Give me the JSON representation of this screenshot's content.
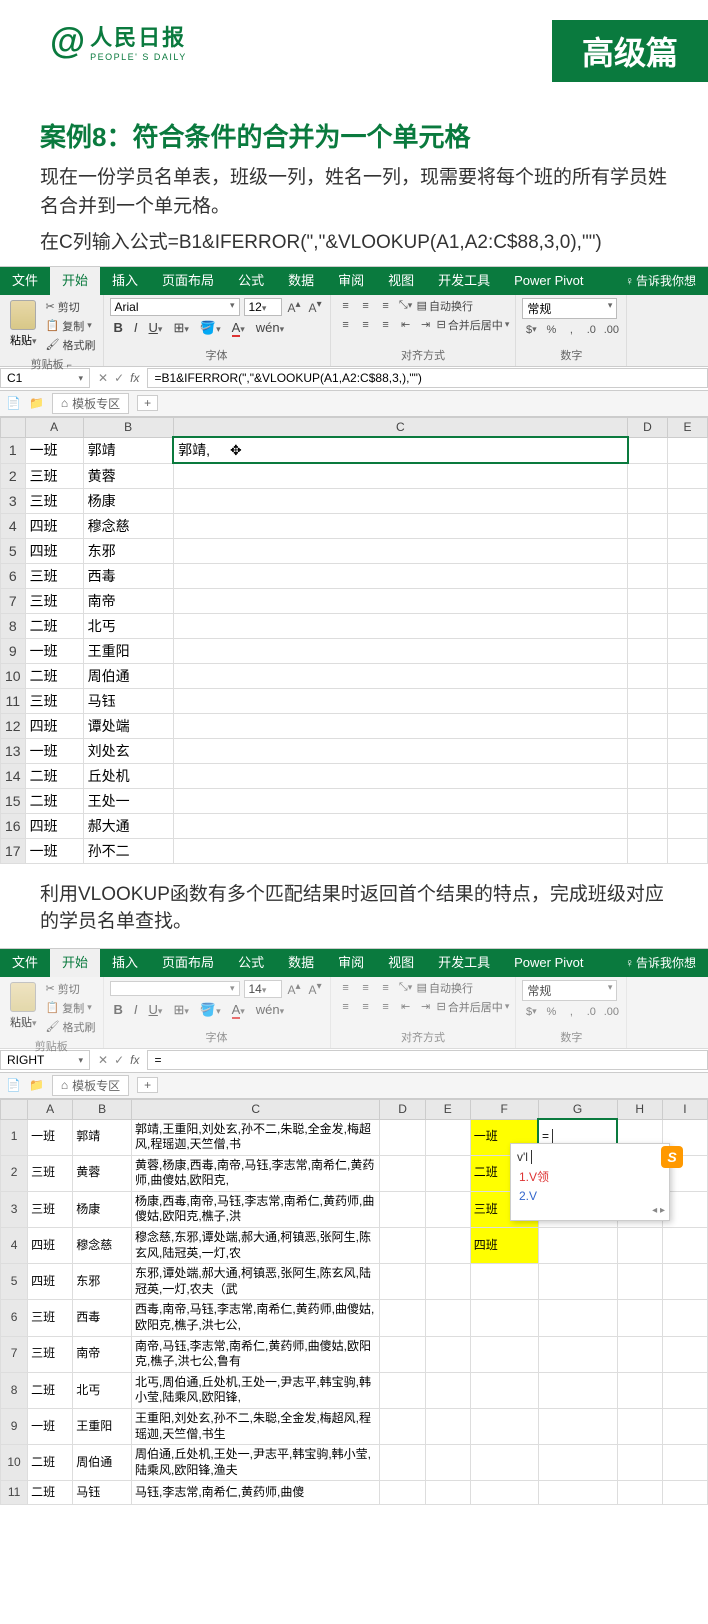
{
  "header": {
    "logo_at": "@",
    "logo_cn": "人民日报",
    "logo_en": "PEOPLE' S DAILY",
    "badge": "高级篇"
  },
  "case": {
    "title": "案例8：符合条件的合并为一个单元格",
    "desc": "现在一份学员名单表，班级一列，姓名一列，现需要将每个班的所有学员姓名合并到一个单元格。",
    "formula_desc": "在C列输入公式=B1&IFERROR(\",\"&VLOOKUP(A1,A2:C$88,3,0),\"\")"
  },
  "ribbon": {
    "tabs": [
      "文件",
      "开始",
      "插入",
      "页面布局",
      "公式",
      "数据",
      "审阅",
      "视图",
      "开发工具",
      "Power Pivot"
    ],
    "tell": "告诉我你想",
    "paste": "粘贴",
    "cut": "剪切",
    "copy": "复制",
    "painter": "格式刷",
    "clipboard": "剪贴板",
    "font": "Arial",
    "size": "12",
    "font_group": "字体",
    "wrap": "自动换行",
    "merge": "合并后居中",
    "align_group": "对齐方式",
    "num_format": "常规",
    "num_group": "数字",
    "wen": "wén"
  },
  "excel1": {
    "namebox": "C1",
    "formula": "=B1&IFERROR(\",\"&VLOOKUP(A1,A2:C$88,3,),\"\")",
    "template": "模板专区",
    "cols": [
      "",
      "A",
      "B",
      "C",
      "D",
      "E"
    ],
    "c1_value": "郭靖,",
    "rows": [
      [
        "1",
        "一班",
        "郭靖"
      ],
      [
        "2",
        "三班",
        "黄蓉"
      ],
      [
        "3",
        "三班",
        "杨康"
      ],
      [
        "4",
        "四班",
        "穆念慈"
      ],
      [
        "5",
        "四班",
        "东邪"
      ],
      [
        "6",
        "三班",
        "西毒"
      ],
      [
        "7",
        "三班",
        "南帝"
      ],
      [
        "8",
        "二班",
        "北丐"
      ],
      [
        "9",
        "一班",
        "王重阳"
      ],
      [
        "10",
        "二班",
        "周伯通"
      ],
      [
        "11",
        "三班",
        "马钰"
      ],
      [
        "12",
        "四班",
        "谭处端"
      ],
      [
        "13",
        "一班",
        "刘处玄"
      ],
      [
        "14",
        "二班",
        "丘处机"
      ],
      [
        "15",
        "二班",
        "王处一"
      ],
      [
        "16",
        "四班",
        "郝大通"
      ],
      [
        "17",
        "一班",
        "孙不二"
      ]
    ]
  },
  "note2": "利用VLOOKUP函数有多个匹配结果时返回首个结果的特点，完成班级对应的学员名单查找。",
  "ribbon2": {
    "size": "14"
  },
  "excel2": {
    "namebox": "RIGHT",
    "formula": "=",
    "cols": [
      "",
      "A",
      "B",
      "C",
      "D",
      "E",
      "F",
      "G",
      "H",
      "I"
    ],
    "g1_value": "=",
    "class_col": [
      "一班",
      "二班",
      "三班",
      "四班"
    ],
    "rows": [
      [
        "1",
        "一班",
        "郭靖",
        "郭靖,王重阳,刘处玄,孙不二,朱聪,全金发,梅超风,程瑶迦,天竺僧,书"
      ],
      [
        "2",
        "三班",
        "黄蓉",
        "黄蓉,杨康,西毒,南帝,马钰,李志常,南希仁,黄药师,曲傻姑,欧阳克,"
      ],
      [
        "3",
        "三班",
        "杨康",
        "杨康,西毒,南帝,马钰,李志常,南希仁,黄药师,曲傻姑,欧阳克,樵子,洪"
      ],
      [
        "4",
        "四班",
        "穆念慈",
        "穆念慈,东邪,谭处端,郝大通,柯镇恶,张阿生,陈玄风,陆冠英,一灯,农"
      ],
      [
        "5",
        "四班",
        "东邪",
        "东邪,谭处端,郝大通,柯镇恶,张阿生,陈玄风,陆冠英,一灯,农夫（武"
      ],
      [
        "6",
        "三班",
        "西毒",
        "西毒,南帝,马钰,李志常,南希仁,黄药师,曲傻姑,欧阳克,樵子,洪七公,"
      ],
      [
        "7",
        "三班",
        "南帝",
        "南帝,马钰,李志常,南希仁,黄药师,曲傻姑,欧阳克,樵子,洪七公,鲁有"
      ],
      [
        "8",
        "二班",
        "北丐",
        "北丐,周伯通,丘处机,王处一,尹志平,韩宝驹,韩小莹,陆乘风,欧阳锋,"
      ],
      [
        "9",
        "一班",
        "王重阳",
        "王重阳,刘处玄,孙不二,朱聪,全金发,梅超风,程瑶迦,天竺僧,书生"
      ],
      [
        "10",
        "二班",
        "周伯通",
        "周伯通,丘处机,王处一,尹志平,韩宝驹,韩小莹,陆乘风,欧阳锋,渔夫"
      ],
      [
        "11",
        "二班",
        "马钰",
        "马钰,李志常,南希仁,黄药师,曲傻"
      ]
    ],
    "ime": {
      "input": "v'l",
      "opt1": "1.V领",
      "opt2": "2.V"
    }
  }
}
